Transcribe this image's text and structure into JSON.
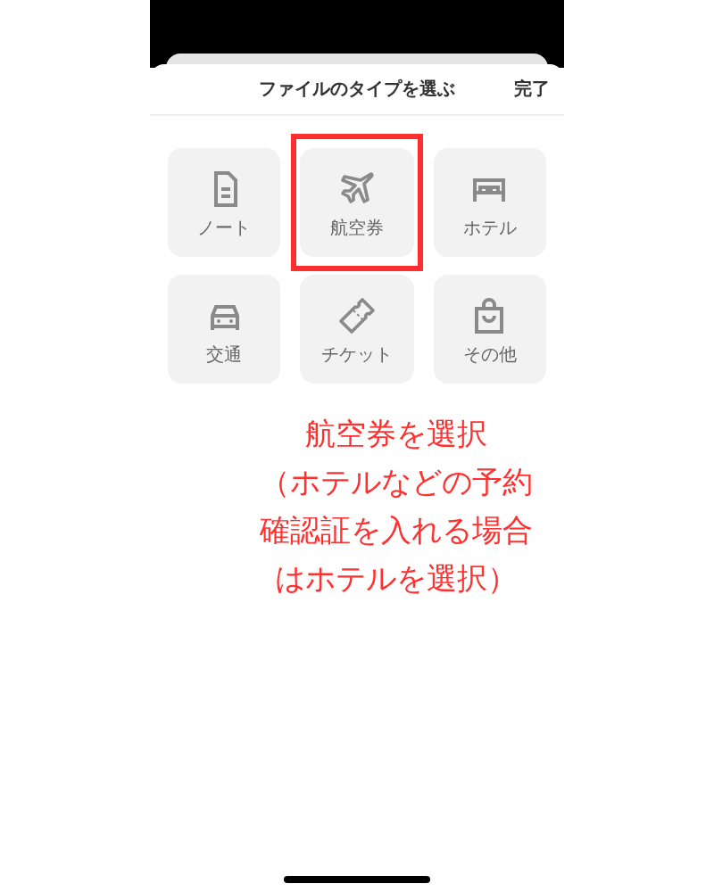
{
  "sheet": {
    "title": "ファイルのタイプを選ぶ",
    "done": "完了"
  },
  "types": [
    {
      "label": "ノート",
      "kind": "note",
      "highlighted": false
    },
    {
      "label": "航空券",
      "kind": "plane",
      "highlighted": true
    },
    {
      "label": "ホテル",
      "kind": "bed",
      "highlighted": false
    },
    {
      "label": "交通",
      "kind": "car",
      "highlighted": false
    },
    {
      "label": "チケット",
      "kind": "ticket",
      "highlighted": false
    },
    {
      "label": "その他",
      "kind": "bag",
      "highlighted": false
    }
  ],
  "annotation": [
    "航空券を選択",
    "（ホテルなどの予約",
    "確認証を入れる場合",
    "はホテルを選択）"
  ]
}
